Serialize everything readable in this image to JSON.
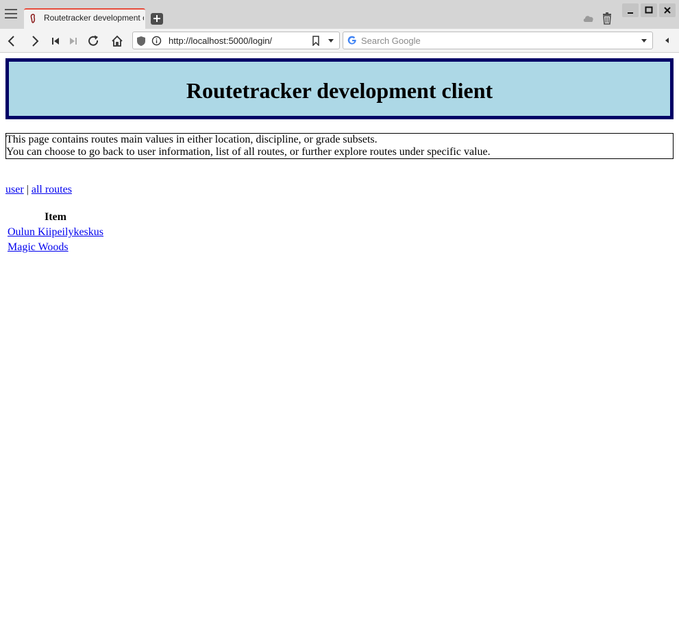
{
  "browser": {
    "tab_title": "Routetracker development client",
    "url": "http://localhost:5000/login/",
    "search_placeholder": "Search Google"
  },
  "page": {
    "heading": "Routetracker development client",
    "description": [
      "This page contains routes main values in either location, discipline, or grade subsets.",
      "You can choose to go back to user information, list of all routes, or further explore routes under specific value."
    ],
    "nav": {
      "user_label": "user",
      "separator": "|",
      "all_routes_label": "all routes"
    },
    "table": {
      "header": "Item",
      "rows": [
        "Oulun Kiipeilykeskus",
        "Magic Woods"
      ]
    }
  },
  "colors": {
    "header_bg": "#add8e6",
    "header_border": "#000066",
    "link": "#0000ee"
  }
}
